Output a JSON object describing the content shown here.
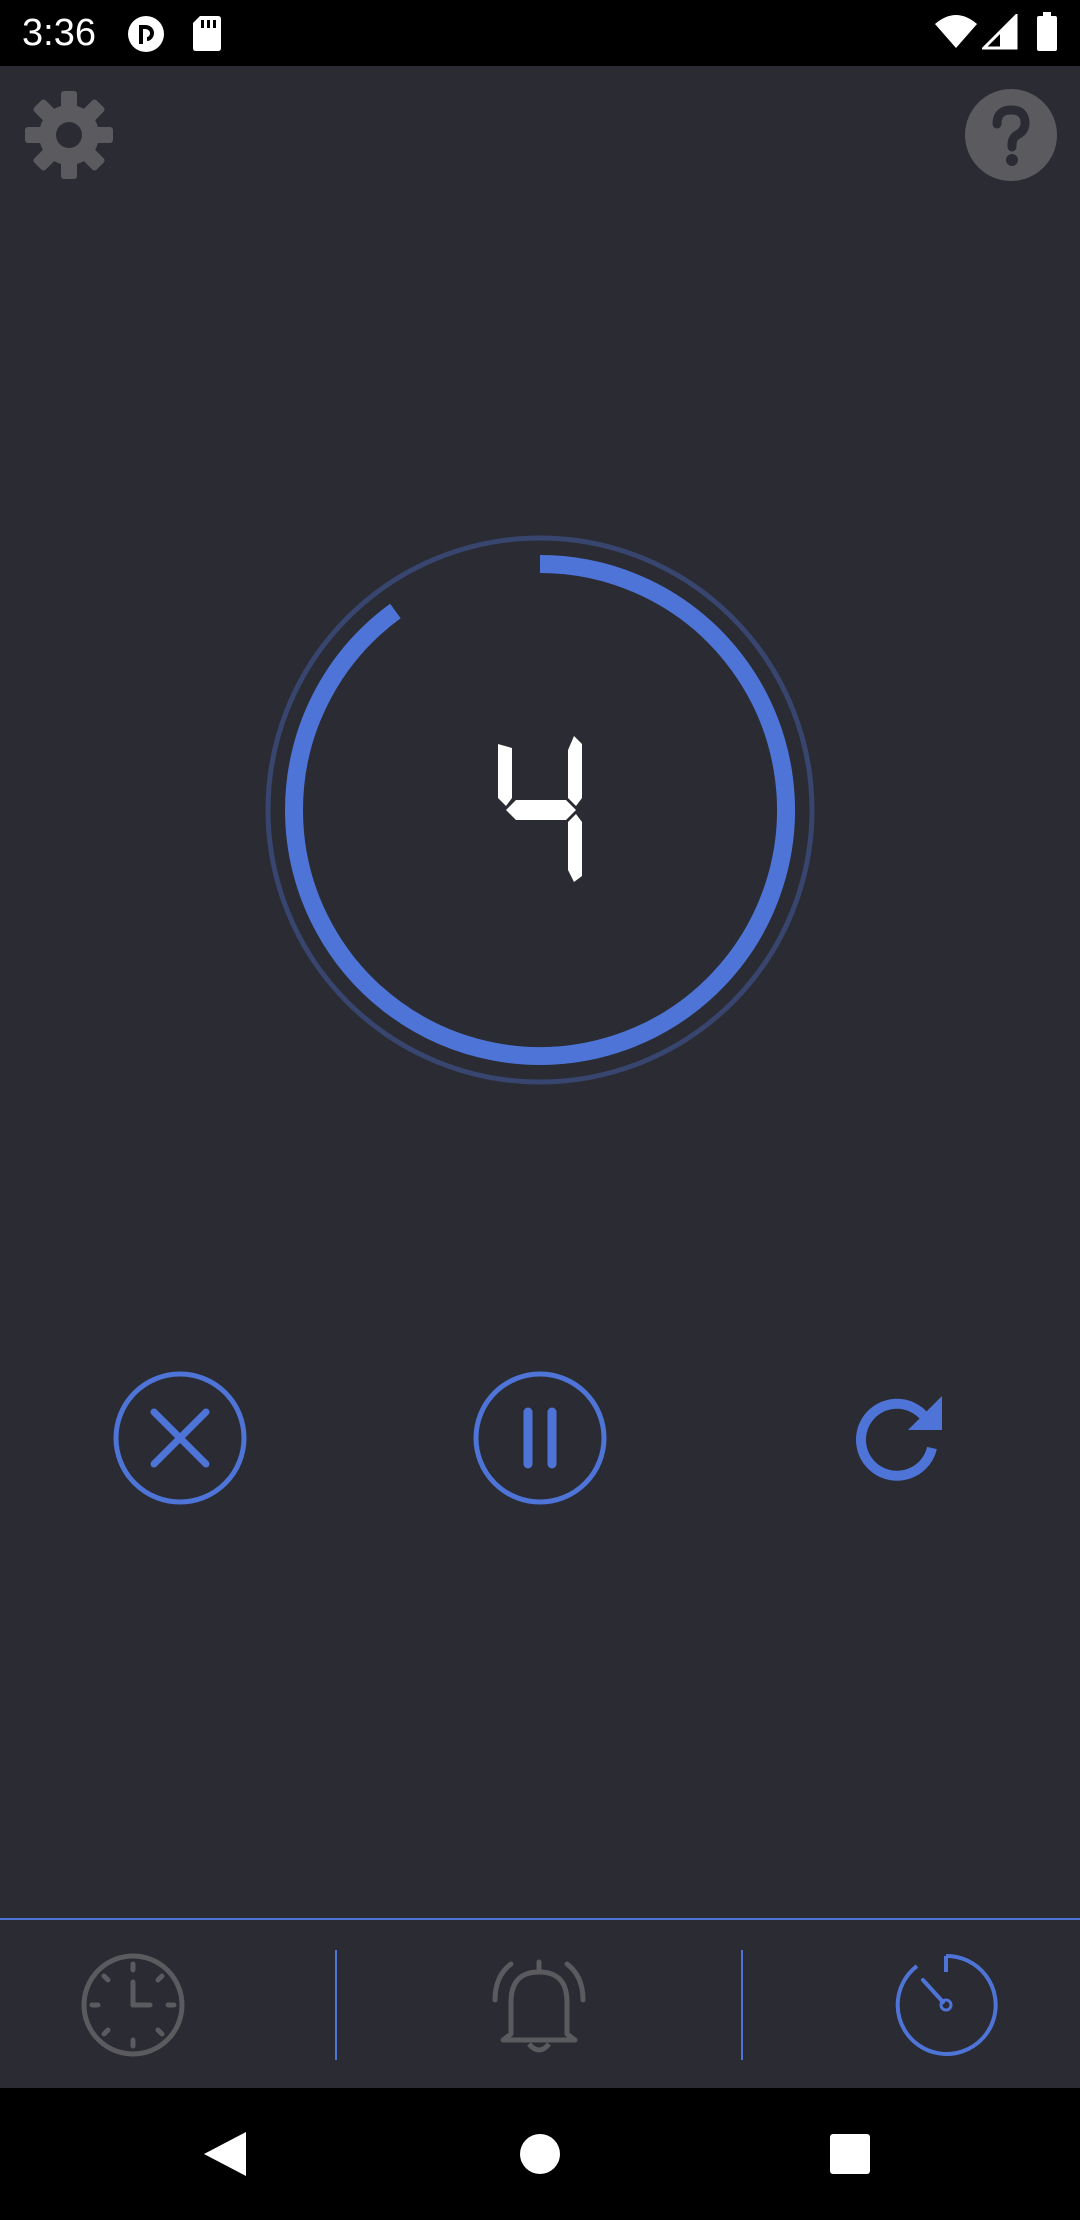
{
  "status_bar": {
    "time": "3:36",
    "left_icons": [
      "pocket-casts-icon",
      "sd-card-icon"
    ],
    "right_icons": [
      "wifi-icon",
      "cellular-signal-icon",
      "battery-icon"
    ]
  },
  "toolbar": {
    "settings_icon": "gear-icon",
    "help_icon": "help-icon"
  },
  "timer": {
    "display_value": "4",
    "progress_fraction": 0.9,
    "ring_color": "#4d74d6",
    "outer_ring_color": "#38456e"
  },
  "controls": {
    "cancel_icon": "cancel-icon",
    "pause_icon": "pause-icon",
    "restart_icon": "restart-icon"
  },
  "bottom_nav": {
    "items": [
      {
        "icon": "clock-icon",
        "active": false
      },
      {
        "icon": "alarm-bell-icon",
        "active": false
      },
      {
        "icon": "timer-icon",
        "active": true
      }
    ]
  },
  "system_nav": {
    "buttons": [
      "back-icon",
      "home-icon",
      "recents-icon"
    ]
  },
  "colors": {
    "background": "#2a2b33",
    "accent": "#4d74d6",
    "inactive_icon": "#5a5a5f",
    "digit": "#ffffff"
  }
}
